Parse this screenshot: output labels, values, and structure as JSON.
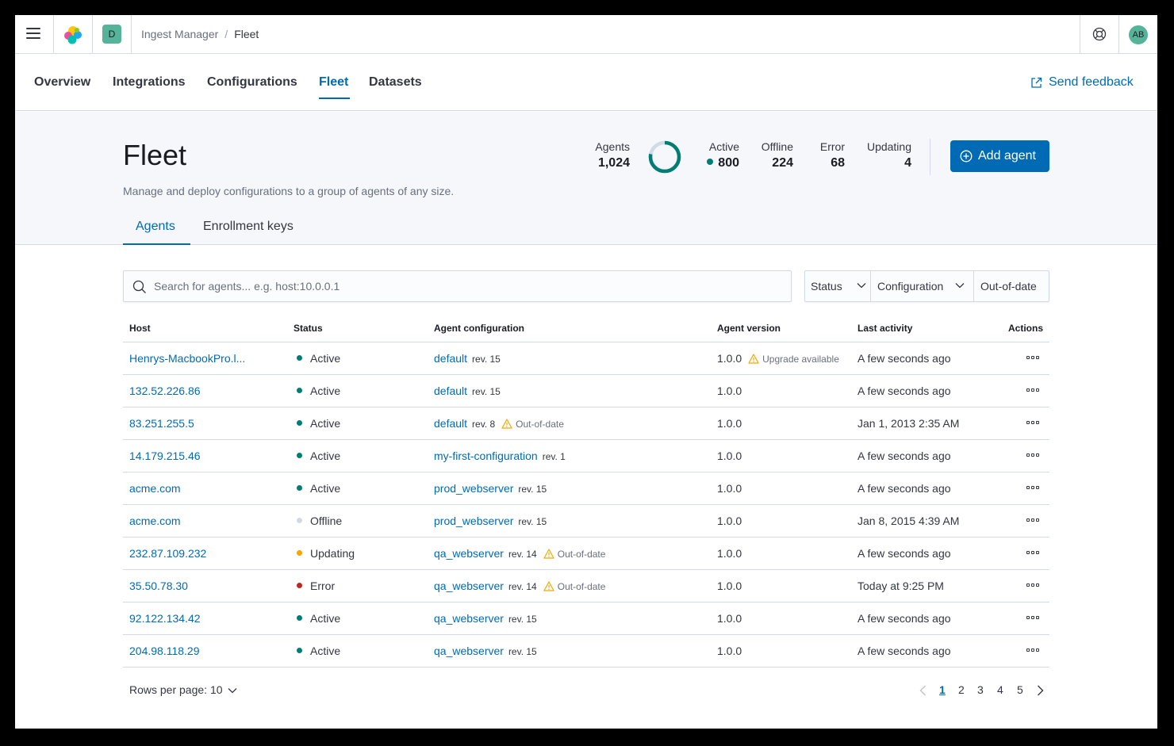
{
  "breadcrumb": {
    "parent": "Ingest Manager",
    "current": "Fleet"
  },
  "space_badge": "D",
  "user_initials": "AB",
  "nav": {
    "tabs": [
      "Overview",
      "Integrations",
      "Configurations",
      "Fleet",
      "Datasets"
    ],
    "active": "Fleet",
    "feedback": "Send feedback"
  },
  "header": {
    "title": "Fleet",
    "description": "Manage and deploy configurations to a group of agents of any size.",
    "add_button": "Add agent"
  },
  "stats": {
    "agents_label": "Agents",
    "agents_value": "1,024",
    "active_label": "Active",
    "active_value": "800",
    "offline_label": "Offline",
    "offline_value": "224",
    "error_label": "Error",
    "error_value": "68",
    "updating_label": "Updating",
    "updating_value": "4",
    "active_fraction": 0.78
  },
  "subtabs": [
    "Agents",
    "Enrollment keys"
  ],
  "search": {
    "placeholder": "Search for agents... e.g. host:10.0.0.1"
  },
  "filters": [
    "Status",
    "Configuration",
    "Out-of-date"
  ],
  "table": {
    "headers": [
      "Host",
      "Status",
      "Agent configuration",
      "Agent version",
      "Last activity",
      "Actions"
    ],
    "rows": [
      {
        "host": "Henrys-MacbookPro.l...",
        "status": "Active",
        "config": "default",
        "rev": "rev. 15",
        "config_warning": "",
        "version": "1.0.0",
        "version_warning": "Upgrade available",
        "last": "A few seconds ago"
      },
      {
        "host": "132.52.226.86",
        "status": "Active",
        "config": "default",
        "rev": "rev. 15",
        "config_warning": "",
        "version": "1.0.0",
        "version_warning": "",
        "last": "A few seconds ago"
      },
      {
        "host": "83.251.255.5",
        "status": "Active",
        "config": "default",
        "rev": "rev. 8",
        "config_warning": "Out-of-date",
        "version": "1.0.0",
        "version_warning": "",
        "last": "Jan 1, 2013 2:35 AM"
      },
      {
        "host": "14.179.215.46",
        "status": "Active",
        "config": "my-first-configuration",
        "rev": "rev. 1",
        "config_warning": "",
        "version": "1.0.0",
        "version_warning": "",
        "last": "A few seconds ago"
      },
      {
        "host": "acme.com",
        "status": "Active",
        "config": "prod_webserver",
        "rev": "rev. 15",
        "config_warning": "",
        "version": "1.0.0",
        "version_warning": "",
        "last": "A few seconds ago"
      },
      {
        "host": "acme.com",
        "status": "Offline",
        "config": "prod_webserver",
        "rev": "rev. 15",
        "config_warning": "",
        "version": "1.0.0",
        "version_warning": "",
        "last": "Jan 8, 2015 4:39 AM"
      },
      {
        "host": "232.87.109.232",
        "status": "Updating",
        "config": "qa_webserver",
        "rev": "rev. 14",
        "config_warning": "Out-of-date",
        "version": "1.0.0",
        "version_warning": "",
        "last": "A few seconds ago"
      },
      {
        "host": "35.50.78.30",
        "status": "Error",
        "config": "qa_webserver",
        "rev": "rev. 14",
        "config_warning": "Out-of-date",
        "version": "1.0.0",
        "version_warning": "",
        "last": "Today at 9:25 PM"
      },
      {
        "host": "92.122.134.42",
        "status": "Active",
        "config": "qa_webserver",
        "rev": "rev. 15",
        "config_warning": "",
        "version": "1.0.0",
        "version_warning": "",
        "last": "A few seconds ago"
      },
      {
        "host": "204.98.118.29",
        "status": "Active",
        "config": "qa_webserver",
        "rev": "rev. 15",
        "config_warning": "",
        "version": "1.0.0",
        "version_warning": "",
        "last": "A few seconds ago"
      }
    ]
  },
  "status_colors": {
    "Active": "#017d73",
    "Offline": "#d3dae6",
    "Updating": "#f5a700",
    "Error": "#bd271e"
  },
  "pagination": {
    "rows_per_page": "Rows per page: 10",
    "pages": [
      "1",
      "2",
      "3",
      "4",
      "5"
    ],
    "current": "1"
  }
}
